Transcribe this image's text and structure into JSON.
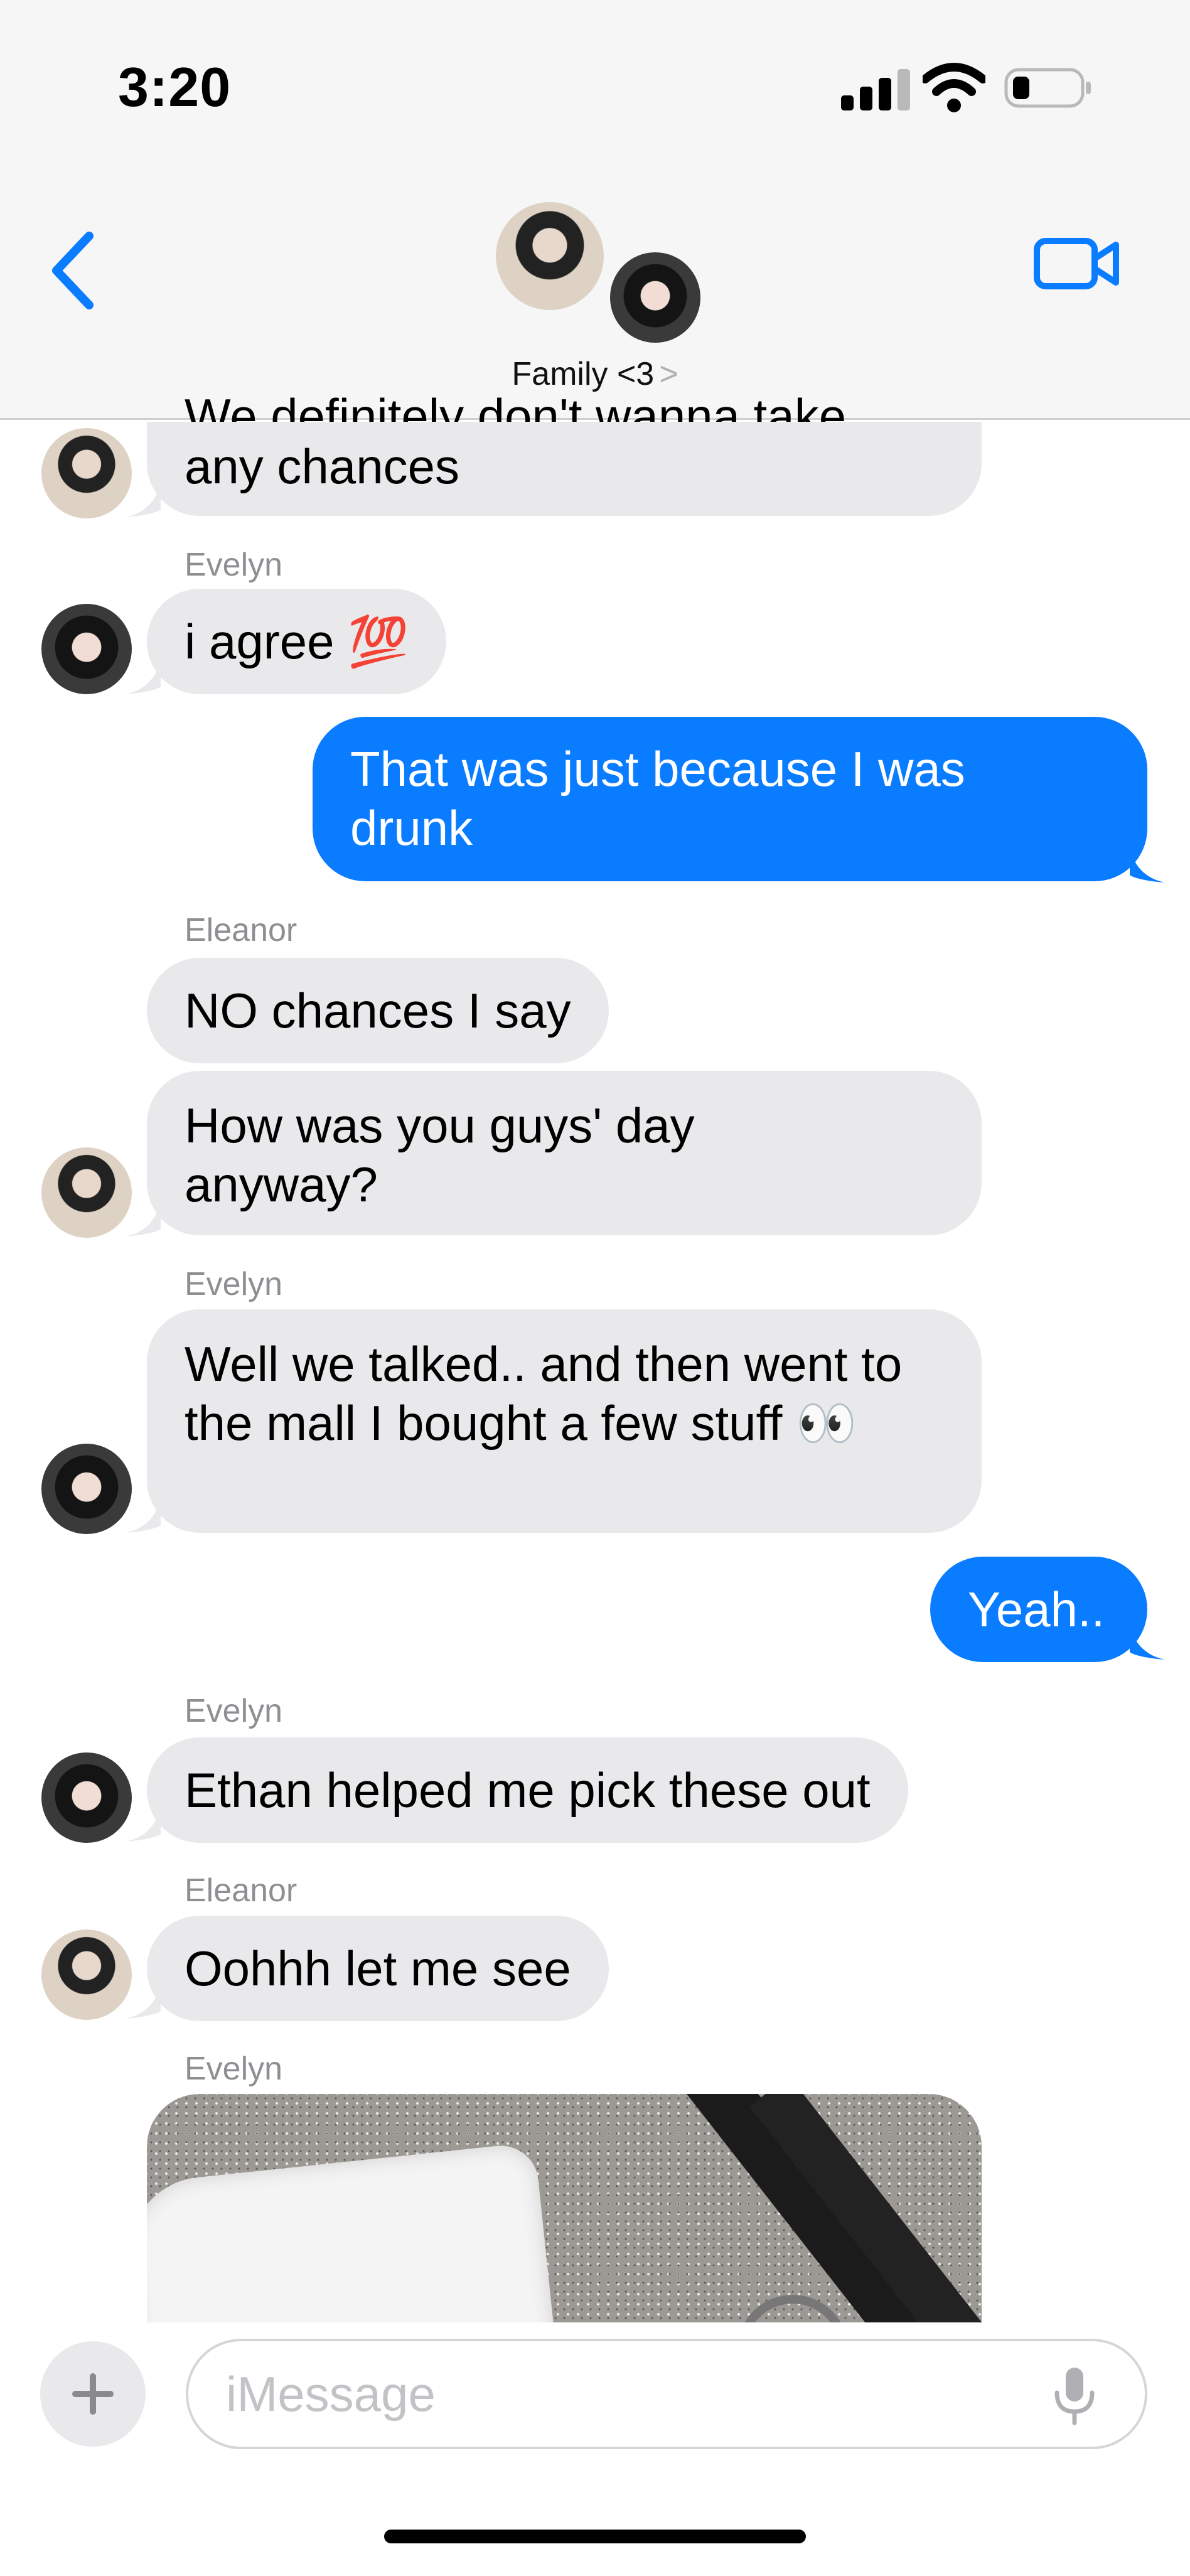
{
  "status_bar": {
    "time": "3:20"
  },
  "header": {
    "title": "Family <3",
    "chevron": ">"
  },
  "messages": {
    "m1": {
      "text": "any chances",
      "partial_text": "We definitely don't wanna take"
    },
    "m2": {
      "sender": "Evelyn",
      "text": "i agree 💯"
    },
    "m3": {
      "text": "That was just because I was drunk"
    },
    "m4": {
      "sender": "Eleanor",
      "text": "NO chances I say"
    },
    "m5": {
      "text": "How was you guys' day anyway?"
    },
    "m6": {
      "sender": "Evelyn",
      "text": "Well we talked.. and then went to the mall I bought a few stuff 👀"
    },
    "m7": {
      "text": "Yeah.."
    },
    "m8": {
      "sender": "Evelyn",
      "text": "Ethan helped me pick these out"
    },
    "m9": {
      "sender": "Eleanor",
      "text": "Oohhh let me see"
    },
    "m10": {
      "sender": "Evelyn"
    }
  },
  "composer": {
    "placeholder": "iMessage"
  },
  "colors": {
    "accent": "#0A7CFF",
    "incoming": "#E9E9EB",
    "nav_bg": "#F6F6F6"
  },
  "icons": [
    "back-chevron-icon",
    "video-camera-icon",
    "plus-icon",
    "microphone-icon",
    "cellular-signal-icon",
    "wifi-icon",
    "battery-icon"
  ]
}
